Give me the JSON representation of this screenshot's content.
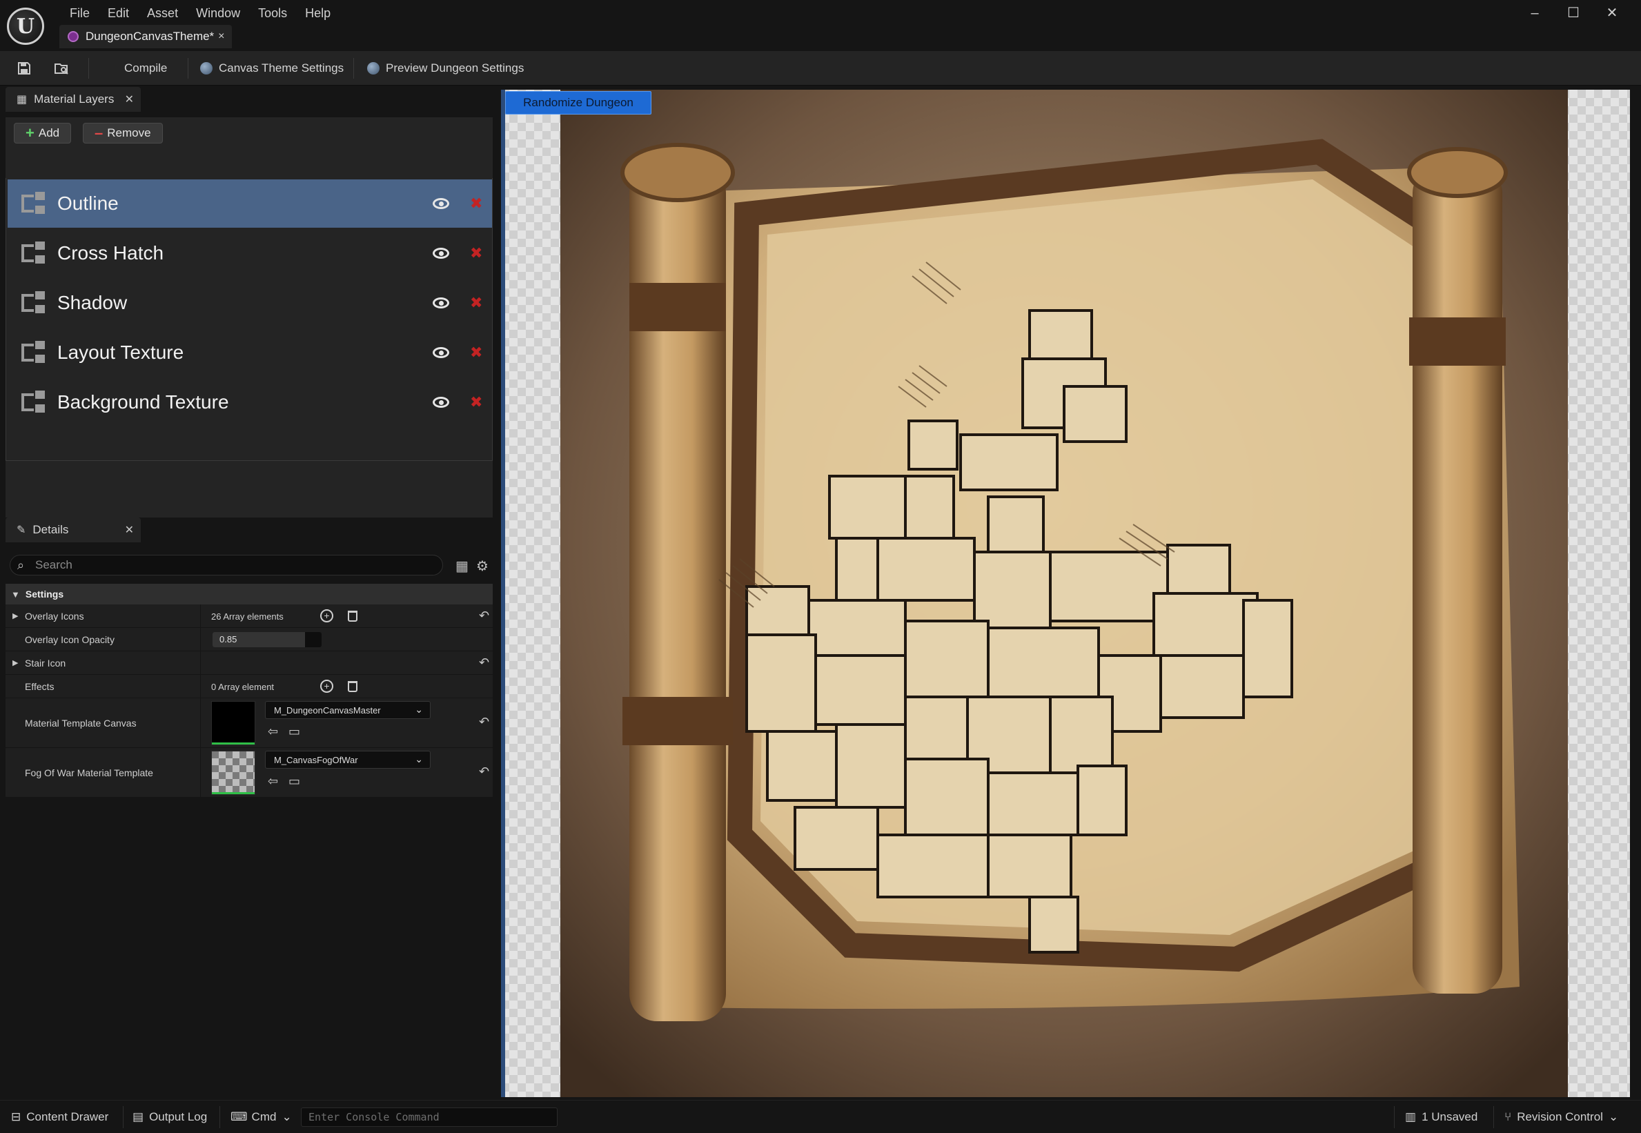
{
  "menu": {
    "items": [
      "File",
      "Edit",
      "Asset",
      "Window",
      "Tools",
      "Help"
    ]
  },
  "document_tab": {
    "label": "DungeonCanvasTheme*",
    "close": "×"
  },
  "window_controls": {
    "minimize": "–",
    "maximize": "☐",
    "close": "✕"
  },
  "toolbar": {
    "compile": "Compile",
    "canvas_theme_settings": "Canvas Theme Settings",
    "preview_dungeon_settings": "Preview Dungeon Settings"
  },
  "material_layers_panel": {
    "title": "Material Layers",
    "add_label": "Add",
    "remove_label": "Remove",
    "layers": [
      {
        "label": "Outline",
        "selected": true
      },
      {
        "label": "Cross Hatch",
        "selected": false
      },
      {
        "label": "Shadow",
        "selected": false
      },
      {
        "label": "Layout Texture",
        "selected": false
      },
      {
        "label": "Background Texture",
        "selected": false
      }
    ]
  },
  "details_panel": {
    "title": "Details",
    "search_placeholder": "Search",
    "section": "Settings",
    "properties": {
      "overlay_icons": {
        "name": "Overlay Icons",
        "value": "26 Array elements"
      },
      "overlay_icon_opacity": {
        "name": "Overlay Icon Opacity",
        "value": "0.85",
        "fill_fraction": 0.85
      },
      "stair_icon": {
        "name": "Stair Icon"
      },
      "effects": {
        "name": "Effects",
        "value": "0 Array element"
      },
      "material_template_canvas": {
        "name": "Material Template Canvas",
        "value": "M_DungeonCanvasMaster",
        "thumb_color": "#000000"
      },
      "fog_of_war_template": {
        "name": "Fog Of War Material Template",
        "value": "M_CanvasFogOfWar"
      }
    }
  },
  "viewport": {
    "randomize_button": "Randomize Dungeon"
  },
  "statusbar": {
    "content_drawer": "Content Drawer",
    "output_log": "Output Log",
    "cmd": "Cmd",
    "console_placeholder": "Enter Console Command",
    "unsaved": "1 Unsaved",
    "revision_control": "Revision Control"
  },
  "colors": {
    "selected_layer": "#4a6488",
    "accent_blue": "#1e6ad4",
    "delete_red": "#c32323",
    "add_green": "#5fd16a",
    "panel_bg": "#242424",
    "app_bg": "#151515"
  }
}
